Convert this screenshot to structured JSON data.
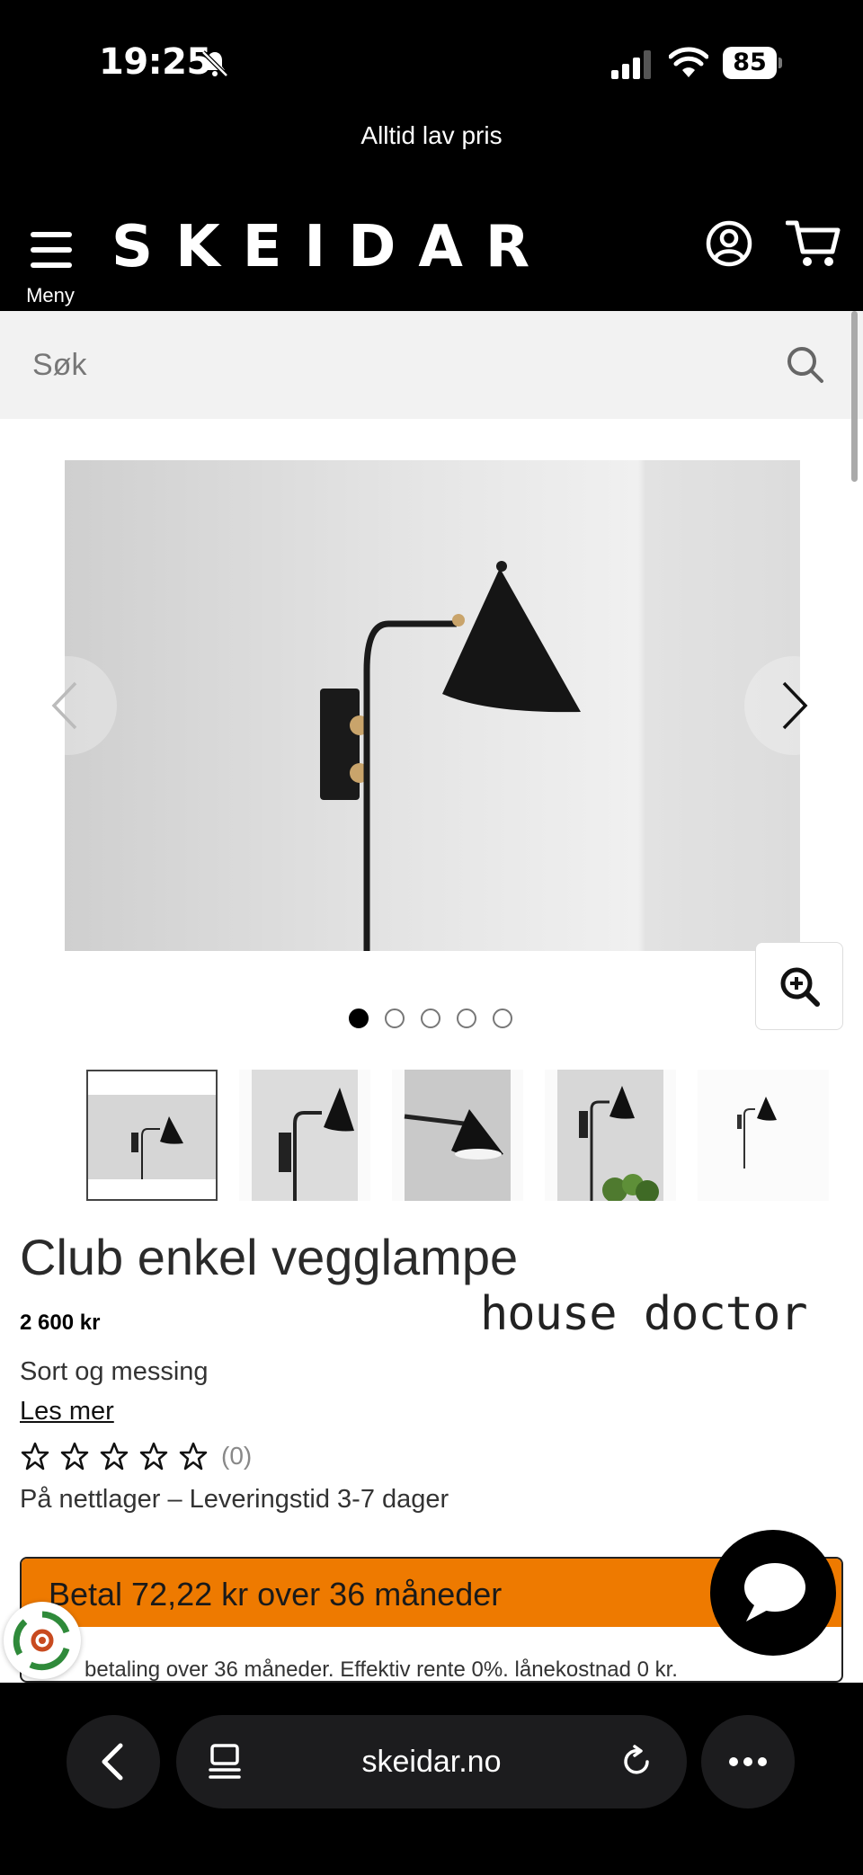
{
  "status_bar": {
    "time": "19:25",
    "battery": "85",
    "icons": [
      "bell-slash-icon",
      "signal-icon",
      "wifi-icon",
      "battery-icon"
    ]
  },
  "promo": {
    "text": "Alltid lav pris"
  },
  "header": {
    "menu_label": "Meny",
    "logo": "SKEIDAR",
    "icons": [
      "menu-icon",
      "account-icon",
      "cart-icon"
    ]
  },
  "search": {
    "placeholder": "Søk",
    "icon": "search-icon"
  },
  "gallery": {
    "image_count": 5,
    "active_index": 0,
    "icons": [
      "chevron-left-icon",
      "chevron-right-icon",
      "zoom-in-icon"
    ]
  },
  "product": {
    "title": "Club enkel vegglampe",
    "price": "2 600 kr",
    "brand": "house doctor",
    "variant": "Sort og messing",
    "read_more": "Les mer",
    "rating": 0,
    "review_count": "(0)",
    "stock": "På nettlager – Leveringstid 3-7 dager"
  },
  "financing": {
    "headline": "Betal 72,22 kr over 36 måneder",
    "body": "betaling over 36 måneder. Effektiv rente 0%. lånekostnad 0 kr."
  },
  "browser": {
    "url": "skeidar.no",
    "icons": [
      "back-icon",
      "tabs-icon",
      "reload-icon",
      "more-icon"
    ]
  },
  "colors": {
    "brand_black": "#000000",
    "financing_orange": "#ee7a00",
    "search_bg": "#f2f2f2"
  }
}
